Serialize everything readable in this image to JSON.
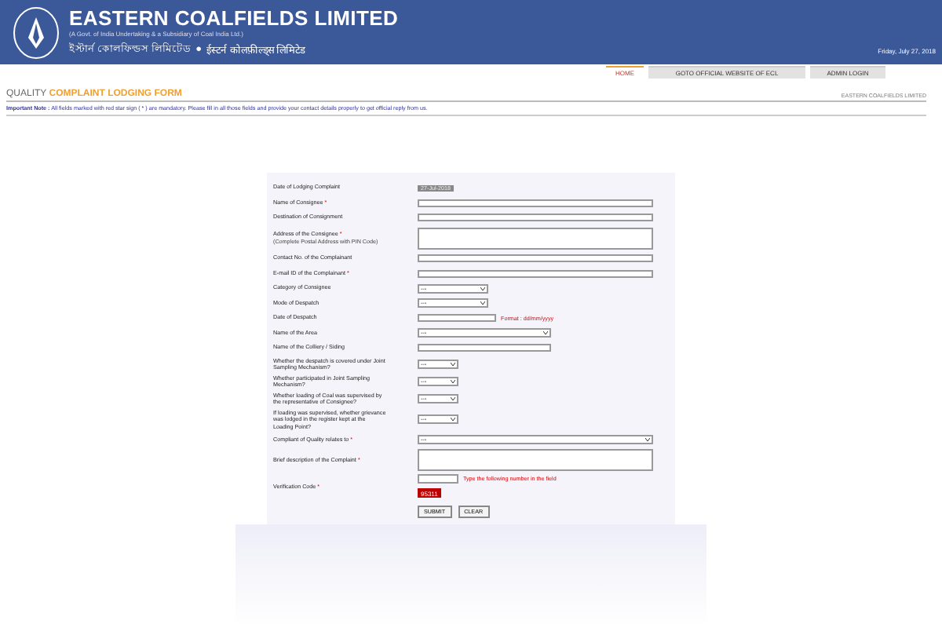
{
  "header": {
    "title": "EASTERN COALFIELDS LIMITED",
    "subtitle": "(A Govt. of India Undertaking & a Subsidiary of Coal India Ltd.)",
    "regional_name_1": "ইস্টার্ন কোলফিল্ডস লিমিটেড",
    "separator": "●",
    "regional_name_2": "ईस्टर्न कोलफ़ील्ड्स लिमिटेड",
    "date": "Friday, July 27, 2018"
  },
  "nav": [
    {
      "label": "HOME",
      "selected": true
    },
    {
      "label": "GOTO OFFICIAL WEBSITE OF ECL",
      "selected": false
    },
    {
      "label": "ADMIN LOGIN",
      "selected": false
    }
  ],
  "page_title": {
    "prefix": "QUALITY",
    "main": "COMPLAINT LODGING FORM",
    "company": "EASTERN COALFIELDS LIMITED"
  },
  "note": {
    "label": "Important Note :",
    "text": "All fields marked with red star sign ( * ) are mandatory. Please fill in all those fields and provide your contact details properly to get official reply from us."
  },
  "form": {
    "rows": [
      {
        "label": "Date of Lodging Complaint",
        "kind": "display",
        "value": "27-Jul-2018"
      },
      {
        "label": "Name of Consignee",
        "required": "*",
        "kind": "text"
      },
      {
        "label": "Destination of Consignment",
        "kind": "text"
      },
      {
        "label": "Address of the Consignee",
        "required": "*",
        "sublabel": "(Complete Postal Address with PIN Code)",
        "kind": "textarea"
      },
      {
        "label": "Contact No. of the Complainant",
        "kind": "text"
      },
      {
        "label": "E-mail ID of the Complainant",
        "required": "*",
        "kind": "text"
      },
      {
        "label": "Category of Consignee",
        "kind": "select",
        "value": "---"
      },
      {
        "label": "Mode of Despatch",
        "kind": "select",
        "value": "---"
      },
      {
        "label": "Date of Despatch",
        "kind": "date",
        "hint": "Format : dd/mm/yyyy"
      },
      {
        "label": "Name of the Area",
        "kind": "areaselect",
        "value": "---"
      },
      {
        "label": "Name of the Colliery / Siding",
        "kind": "shorttext"
      },
      {
        "label": "Whether the despatch is covered under Joint Sampling Mechanism?",
        "kind": "smallselect",
        "value": "---"
      },
      {
        "label": "Whether participated in Joint Sampling Mechanism?",
        "kind": "smallselect",
        "value": "---"
      },
      {
        "label": "Whether loading of Coal was supervised by the representative of Consignee?",
        "kind": "smallselect",
        "value": "---"
      },
      {
        "label": "If loading was supervised, whether grievance was lodged in the register kept at the Loading Point?",
        "kind": "smallselect",
        "value": "---"
      },
      {
        "label": "Compliant of Quality relates to",
        "required": "*",
        "kind": "wideselect",
        "value": "---"
      },
      {
        "label": "Brief description of the Complaint",
        "required": "*",
        "kind": "textarea"
      },
      {
        "label": "Verification Code",
        "required": "*",
        "kind": "captcha",
        "hint": "Type the following number in the field",
        "code": "95311"
      }
    ],
    "buttons": [
      "SUBMIT",
      "CLEAR"
    ]
  }
}
